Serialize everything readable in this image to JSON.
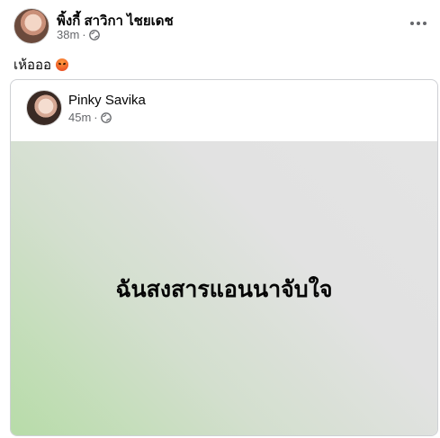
{
  "post": {
    "author_name": "พิ้งกี้ สาวิกา ไชยเดช",
    "time": "38m",
    "separator": "·",
    "audience_icon": "globe-icon",
    "more_icon": "more-horizontal-icon",
    "text": "เห้อออ",
    "emoji_icon": "angry-face-icon"
  },
  "shared_post": {
    "author_name": "Pinky Savika",
    "time": "45m",
    "separator": "·",
    "audience_icon": "globe-icon",
    "message": "ฉันสงสารแอนนาจับใจ",
    "background_colors": [
      "#b7dca8",
      "#e4e4e4"
    ]
  }
}
